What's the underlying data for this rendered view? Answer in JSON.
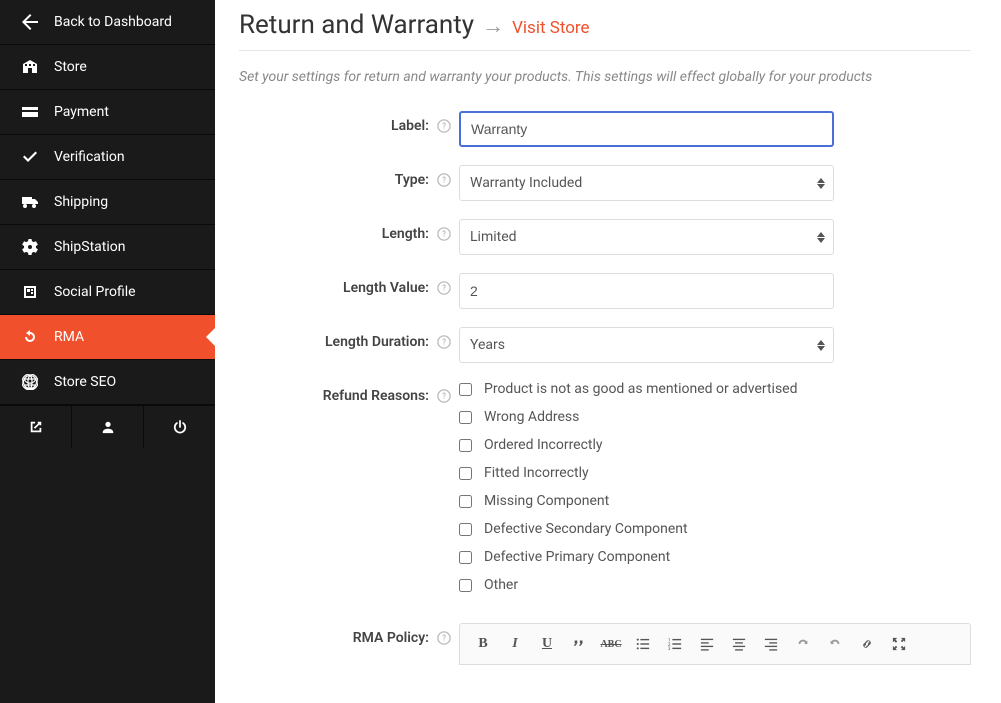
{
  "sidebar": {
    "items": [
      {
        "label": "Back to Dashboard",
        "icon": "arrow-left-icon"
      },
      {
        "label": "Store",
        "icon": "building-icon"
      },
      {
        "label": "Payment",
        "icon": "credit-card-icon"
      },
      {
        "label": "Verification",
        "icon": "check-icon"
      },
      {
        "label": "Shipping",
        "icon": "truck-icon"
      },
      {
        "label": "ShipStation",
        "icon": "gear-icon"
      },
      {
        "label": "Social Profile",
        "icon": "share-icon"
      },
      {
        "label": "RMA",
        "icon": "undo-icon",
        "active": true
      },
      {
        "label": "Store SEO",
        "icon": "globe-icon"
      }
    ],
    "footer": [
      {
        "icon": "external-link-icon"
      },
      {
        "icon": "user-icon"
      },
      {
        "icon": "power-icon"
      }
    ]
  },
  "header": {
    "title": "Return and Warranty",
    "arrow": "→",
    "link": "Visit Store",
    "desc": "Set your settings for return and warranty your products. This settings will effect globally for your products"
  },
  "form": {
    "label_label": "Label:",
    "label_value": "Warranty",
    "type_label": "Type:",
    "type_value": "Warranty Included",
    "length_label": "Length:",
    "length_value": "Limited",
    "length_value_label": "Length Value:",
    "length_value_value": "2",
    "length_duration_label": "Length Duration:",
    "length_duration_value": "Years",
    "refund_reasons_label": "Refund Reasons:",
    "refund_reasons": [
      "Product is not as good as mentioned or advertised",
      "Wrong Address",
      "Ordered Incorrectly",
      "Fitted Incorrectly",
      "Missing Component",
      "Defective Secondary Component",
      "Defective Primary Component",
      "Other"
    ],
    "rma_policy_label": "RMA Policy:"
  },
  "editor": {
    "buttons": [
      "bold",
      "italic",
      "underline",
      "quote",
      "strike",
      "ul",
      "ol",
      "align-left",
      "align-center",
      "align-right",
      "undo",
      "redo",
      "link",
      "fullscreen"
    ]
  }
}
